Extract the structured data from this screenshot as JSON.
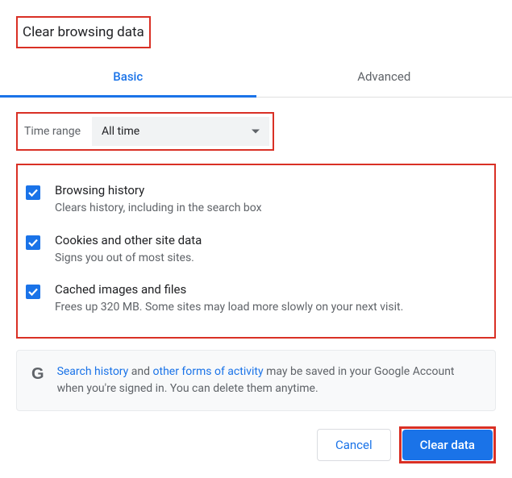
{
  "dialog": {
    "title": "Clear browsing data"
  },
  "tabs": {
    "basic": "Basic",
    "advanced": "Advanced"
  },
  "time_range": {
    "label": "Time range",
    "selected": "All time"
  },
  "options": [
    {
      "title": "Browsing history",
      "desc": "Clears history, including in the search box",
      "checked": true
    },
    {
      "title": "Cookies and other site data",
      "desc": "Signs you out of most sites.",
      "checked": true
    },
    {
      "title": "Cached images and files",
      "desc": "Frees up 320 MB. Some sites may load more slowly on your next visit.",
      "checked": true
    }
  ],
  "info": {
    "link1": "Search history",
    "text1": " and ",
    "link2": "other forms of activity",
    "text2": " may be saved in your Google Account when you're signed in. You can delete them anytime."
  },
  "buttons": {
    "cancel": "Cancel",
    "clear": "Clear data"
  },
  "highlights": {
    "color": "#d93025"
  }
}
